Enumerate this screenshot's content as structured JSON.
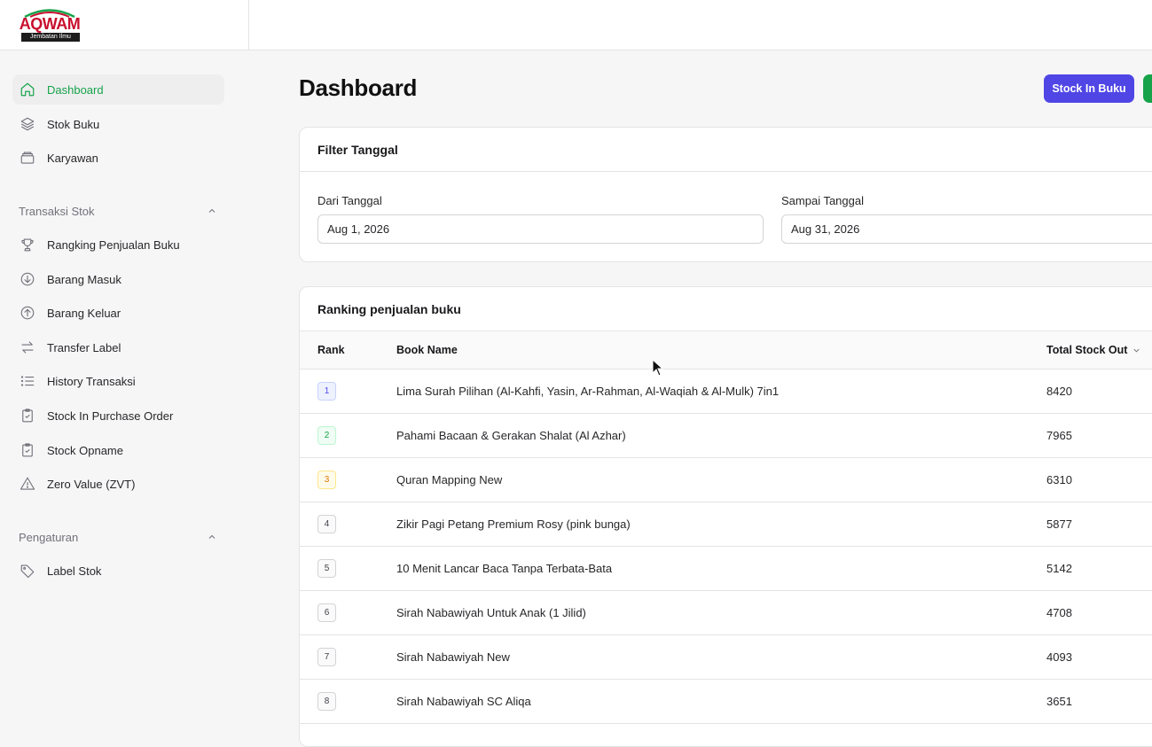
{
  "brand": {
    "logo_text": "AQWAM",
    "tagline": "Jembatan Ilmu"
  },
  "sidebar": {
    "main_items": [
      {
        "label": "Dashboard",
        "icon": "home-icon",
        "active": true
      },
      {
        "label": "Stok Buku",
        "icon": "layers-icon"
      },
      {
        "label": "Karyawan",
        "icon": "archive-icon"
      }
    ],
    "sections": [
      {
        "title": "Transaksi Stok",
        "items": [
          {
            "label": "Rangking Penjualan Buku",
            "icon": "trophy-icon"
          },
          {
            "label": "Barang Masuk",
            "icon": "arrow-down-circle-icon"
          },
          {
            "label": "Barang Keluar",
            "icon": "arrow-up-circle-icon"
          },
          {
            "label": "Transfer Label",
            "icon": "arrows-exchange-icon"
          },
          {
            "label": "History Transaksi",
            "icon": "list-icon"
          },
          {
            "label": "Stock In Purchase Order",
            "icon": "clipboard-check-icon"
          },
          {
            "label": "Stock Opname",
            "icon": "clipboard-check-icon"
          },
          {
            "label": "Zero Value (ZVT)",
            "icon": "warning-icon"
          }
        ]
      },
      {
        "title": "Pengaturan",
        "items": [
          {
            "label": "Label Stok",
            "icon": "tag-icon"
          }
        ]
      }
    ]
  },
  "header": {
    "title": "Dashboard",
    "stock_in_button": "Stock In Buku",
    "accent_indigo": "#4f46e5",
    "accent_green": "#16a34a"
  },
  "filter": {
    "title": "Filter Tanggal",
    "from_label": "Dari Tanggal",
    "from_value": "Aug 1, 2026",
    "to_label": "Sampai Tanggal",
    "to_value": "Aug 31, 2026"
  },
  "ranking": {
    "title": "Ranking penjualan buku",
    "columns": {
      "rank": "Rank",
      "book": "Book Name",
      "total": "Total Stock Out"
    },
    "rows": [
      {
        "rank": "1",
        "book": "Lima Surah Pilihan (Al-Kahfi, Yasin, Ar-Rahman, Al-Waqiah & Al-Mulk) 7in1",
        "total": "8420"
      },
      {
        "rank": "2",
        "book": "Pahami Bacaan & Gerakan Shalat (Al Azhar)",
        "total": "7965"
      },
      {
        "rank": "3",
        "book": "Quran Mapping New",
        "total": "6310"
      },
      {
        "rank": "4",
        "book": "Zikir Pagi Petang Premium Rosy (pink bunga)",
        "total": "5877"
      },
      {
        "rank": "5",
        "book": "10 Menit Lancar Baca Tanpa Terbata-Bata",
        "total": "5142"
      },
      {
        "rank": "6",
        "book": "Sirah Nabawiyah Untuk Anak (1 Jilid)",
        "total": "4708"
      },
      {
        "rank": "7",
        "book": "Sirah Nabawiyah New",
        "total": "4093"
      },
      {
        "rank": "8",
        "book": "Sirah Nabawiyah SC Aliqa",
        "total": "3651"
      }
    ]
  }
}
